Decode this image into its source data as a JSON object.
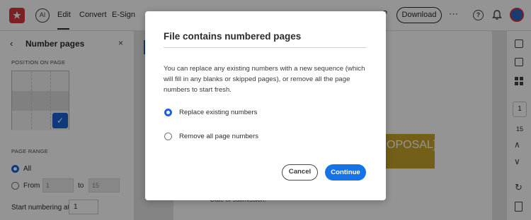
{
  "topbar": {
    "logo_glyph": "★",
    "ai_badge": "AI",
    "menu": [
      "Edit",
      "Convert",
      "E-Sign"
    ],
    "download_label": "Download",
    "more_glyph": "⋯",
    "help_glyph": "?",
    "help_icon_glyph": "?"
  },
  "left_panel": {
    "title": "Number pages",
    "back_glyph": "‹",
    "close_glyph": "×",
    "position_label": "POSITION ON PAGE",
    "check_glyph": "✓",
    "range_label": "PAGE RANGE",
    "all_label": "All",
    "from_label": "From",
    "from_value": "1",
    "to_label": "to",
    "to_value": "15",
    "start_label": "Start numbering at",
    "start_value": "1"
  },
  "document": {
    "gold_text": "OPOSAL]",
    "date_text": "Date of submission:"
  },
  "right_bar": {
    "current_page": "1",
    "total_pages": "15",
    "up_glyph": "∧",
    "down_glyph": "∨",
    "refresh_glyph": "↻"
  },
  "dialog": {
    "title": "File contains numbered pages",
    "body": "You can replace any existing numbers with a new sequence (which will fill in any blanks or skipped pages), or remove all the page numbers to start fresh.",
    "option_replace": "Replace existing numbers",
    "option_remove": "Remove all page numbers",
    "cancel_label": "Cancel",
    "continue_label": "Continue"
  },
  "colors": {
    "accent": "#1473e6",
    "brand": "#d7373f",
    "gold": "#c9a42c"
  }
}
